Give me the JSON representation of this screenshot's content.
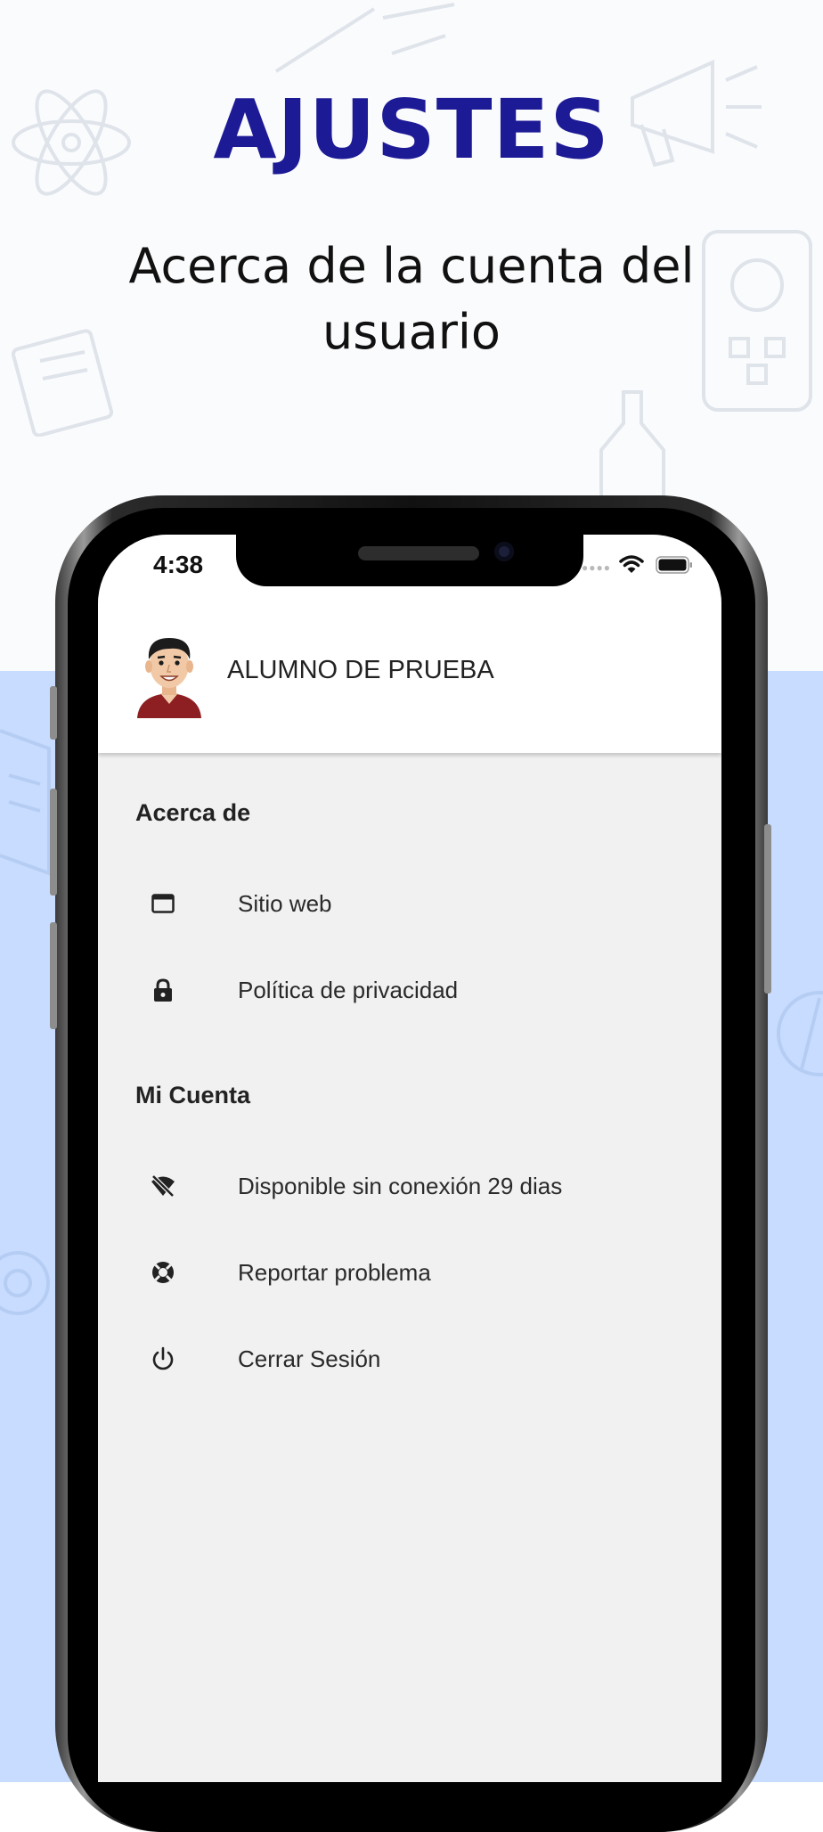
{
  "promo": {
    "title": "AJUSTES",
    "subtitle": "Acerca de la cuenta del usuario"
  },
  "status_bar": {
    "time": "4:38"
  },
  "profile": {
    "name": "ALUMNO DE PRUEBA"
  },
  "sections": [
    {
      "heading": "Acerca de",
      "items": [
        {
          "label": "Sitio web",
          "icon": "browser-window-icon"
        },
        {
          "label": "Política de privacidad",
          "icon": "lock-icon"
        }
      ]
    },
    {
      "heading": "Mi Cuenta",
      "items": [
        {
          "label": "Disponible sin conexión 29 dias",
          "icon": "wifi-off-icon"
        },
        {
          "label": "Reportar problema",
          "icon": "lifebuoy-icon"
        },
        {
          "label": "Cerrar Sesión",
          "icon": "power-icon"
        }
      ]
    }
  ],
  "colors": {
    "title": "#1d1a96",
    "promo_bottom_bg": "#c8dcff",
    "app_bg": "#f1f1f1"
  }
}
